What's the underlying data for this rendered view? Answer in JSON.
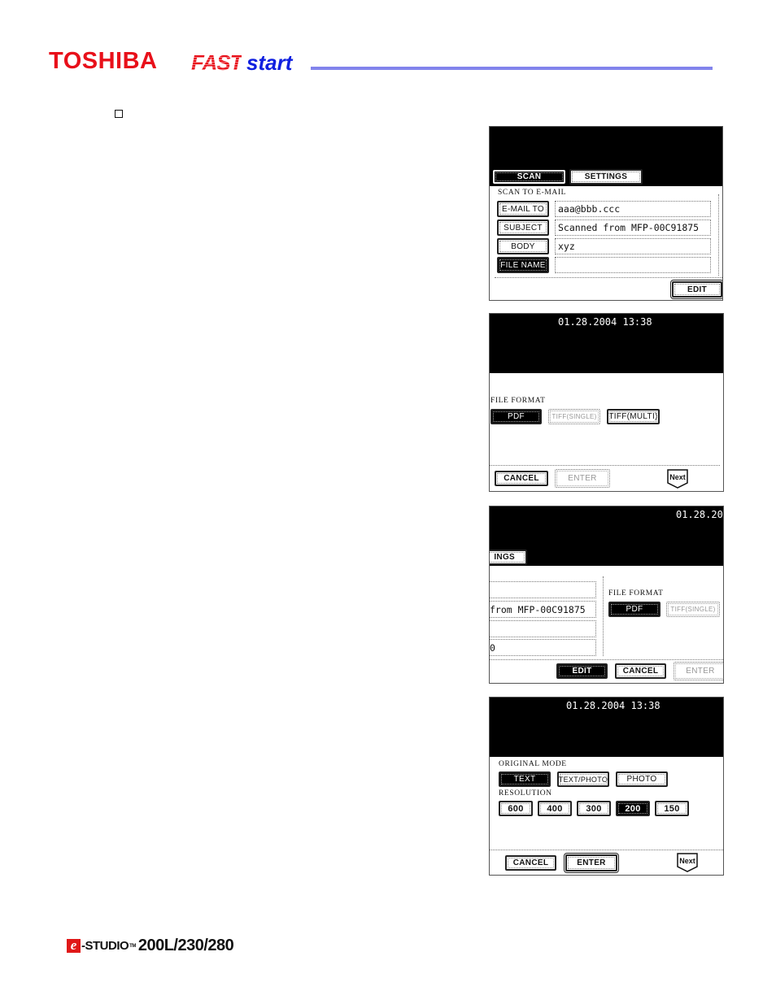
{
  "header": {
    "brand": "TOSHIBA",
    "product_fast": "FAST",
    "product_start": "start",
    "brand_color": "#e8101a",
    "accent_color": "#1020e0",
    "rule_color": "#8284ec"
  },
  "bullet": {
    "icon": "checkbox-icon"
  },
  "panel1": {
    "tabs": [
      "SCAN",
      "SETTINGS"
    ],
    "section": "SCAN TO E-MAIL",
    "rows": [
      {
        "label": "E-MAIL TO",
        "value": "aaa@bbb.ccc"
      },
      {
        "label": "SUBJECT",
        "value": "Scanned from MFP-00C91875"
      },
      {
        "label": "BODY",
        "value": "xyz"
      },
      {
        "label": "FILE NAME",
        "value": ""
      }
    ],
    "edit": "EDIT"
  },
  "panel2": {
    "datetime": "01.28.2004 13:38",
    "section": "FILE FORMAT",
    "formats": [
      "PDF",
      "TIFF(SINGLE)",
      "TIFF(MULTI)"
    ],
    "selected_format": "PDF",
    "cancel": "CANCEL",
    "enter": "ENTER",
    "next": "Next"
  },
  "panel3": {
    "datetime_partial": "01.28.20",
    "tab_partial": "INGS",
    "fields": [
      "",
      "from MFP-00C91875",
      "",
      "0"
    ],
    "section": "FILE FORMAT",
    "formats": [
      "PDF",
      "TIFF(SINGLE)"
    ],
    "edit": "EDIT",
    "cancel": "CANCEL",
    "enter": "ENTER"
  },
  "panel4": {
    "datetime": "01.28.2004 13:38",
    "mode_label": "ORIGINAL MODE",
    "modes": [
      "TEXT",
      "TEXT/PHOTO",
      "PHOTO"
    ],
    "selected_mode": "TEXT",
    "resolution_label": "RESOLUTION",
    "resolutions": [
      "600",
      "400",
      "300",
      "200",
      "150"
    ],
    "selected_resolution": "200",
    "cancel": "CANCEL",
    "enter": "ENTER",
    "next": "Next"
  },
  "footer": {
    "e": "e",
    "studio": "-STUDIO",
    "tm": "TM",
    "models": "200L/230/280"
  }
}
